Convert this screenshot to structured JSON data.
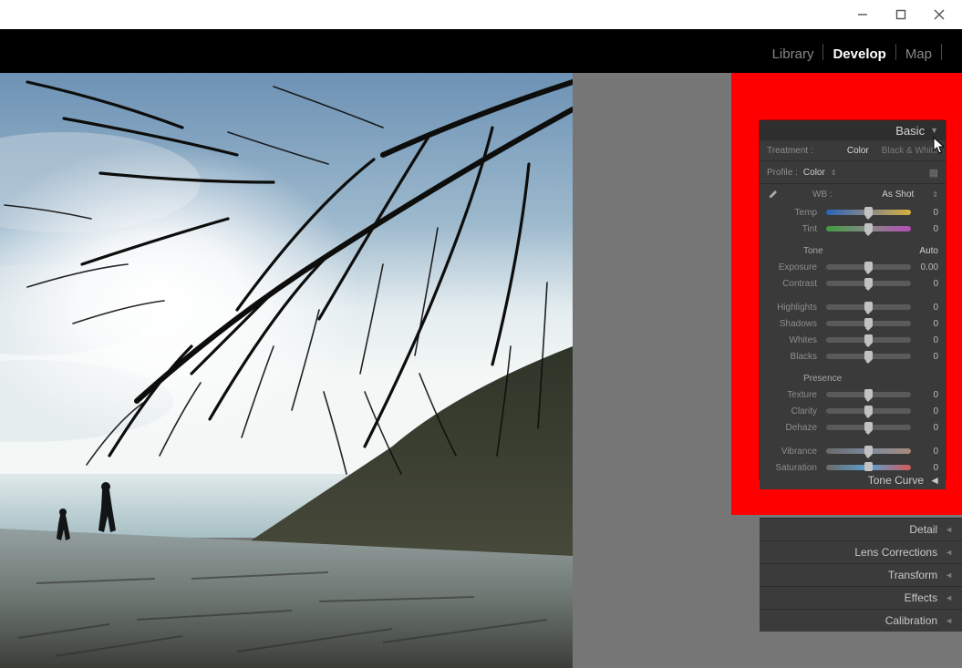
{
  "window": {
    "min_icon": "minimize-icon",
    "max_icon": "maximize-icon",
    "close_icon": "close-icon"
  },
  "modules": {
    "library": "Library",
    "develop": "Develop",
    "map": "Map"
  },
  "basic": {
    "title": "Basic",
    "treatment_label": "Treatment :",
    "treatment_color": "Color",
    "treatment_bw": "Black & White",
    "profile_label": "Profile :",
    "profile_value": "Color",
    "wb_label": "WB :",
    "wb_value": "As Shot",
    "temp_label": "Temp",
    "temp_value": "0",
    "tint_label": "Tint",
    "tint_value": "0",
    "tone_section": "Tone",
    "auto": "Auto",
    "exposure_label": "Exposure",
    "exposure_value": "0.00",
    "contrast_label": "Contrast",
    "contrast_value": "0",
    "highlights_label": "Highlights",
    "highlights_value": "0",
    "shadows_label": "Shadows",
    "shadows_value": "0",
    "whites_label": "Whites",
    "whites_value": "0",
    "blacks_label": "Blacks",
    "blacks_value": "0",
    "presence_section": "Presence",
    "texture_label": "Texture",
    "texture_value": "0",
    "clarity_label": "Clarity",
    "clarity_value": "0",
    "dehaze_label": "Dehaze",
    "dehaze_value": "0",
    "vibrance_label": "Vibrance",
    "vibrance_value": "0",
    "saturation_label": "Saturation",
    "saturation_value": "0"
  },
  "panels": {
    "tone_curve": "Tone Curve",
    "detail": "Detail",
    "lens": "Lens Corrections",
    "transform": "Transform",
    "effects": "Effects",
    "calibration": "Calibration"
  }
}
